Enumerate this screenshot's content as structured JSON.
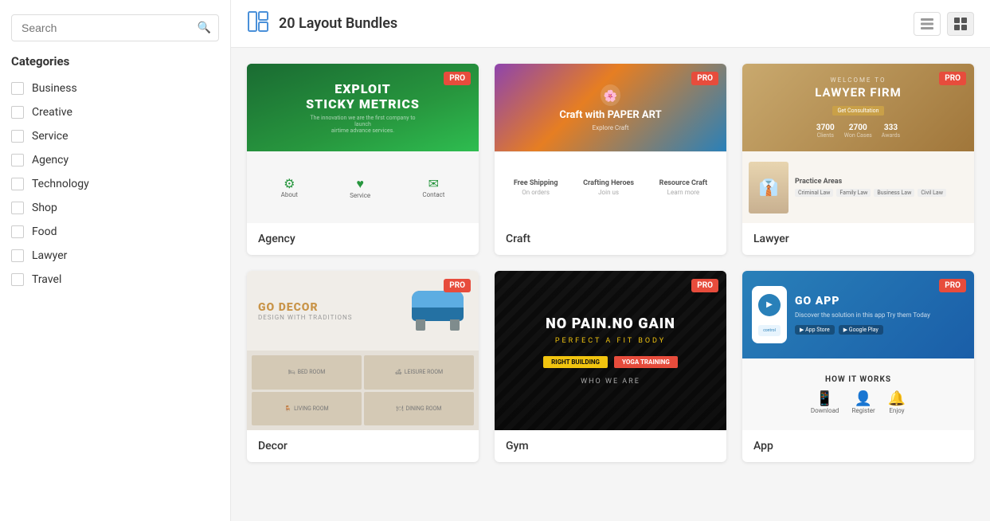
{
  "sidebar": {
    "search_placeholder": "Search",
    "categories_title": "Categories",
    "categories": [
      {
        "label": "Business"
      },
      {
        "label": "Creative"
      },
      {
        "label": "Service"
      },
      {
        "label": "Agency"
      },
      {
        "label": "Technology"
      },
      {
        "label": "Shop"
      },
      {
        "label": "Food"
      },
      {
        "label": "Lawyer"
      },
      {
        "label": "Travel"
      }
    ]
  },
  "header": {
    "title": "20 Layout Bundles",
    "list_view_label": "List view",
    "grid_view_label": "Grid view"
  },
  "cards": [
    {
      "id": "agency",
      "label": "Agency",
      "pro": true,
      "main_text": "EXPLOIT\nSTICKY METRICS",
      "sub_text": "The innovation we are the first company in the world to launch\nairtime advance services."
    },
    {
      "id": "craft",
      "label": "Craft",
      "pro": true,
      "main_text": "Craft with\nPAPER ART",
      "sub_text": "Explore Craft"
    },
    {
      "id": "lawyer",
      "label": "Lawyer",
      "pro": true,
      "main_text": "LAWYER FIRM",
      "welcome": "WELCOME TO"
    },
    {
      "id": "decor",
      "label": "Decor",
      "pro": true,
      "main_text": "GO DECOR",
      "sub_text": "DESIGN WITH TRADITIONS"
    },
    {
      "id": "gym",
      "label": "Gym",
      "pro": true,
      "main_text": "NO PAIN.NO GAIN",
      "sub_text": "PERFECT A FIT BODY"
    },
    {
      "id": "app",
      "label": "App",
      "pro": true,
      "main_text": "GO APP",
      "sub_text": "Discover the solution in this app\nTry them Today",
      "how_it_works": "HOW IT WORKS"
    }
  ],
  "badges": {
    "pro": "PRO"
  }
}
